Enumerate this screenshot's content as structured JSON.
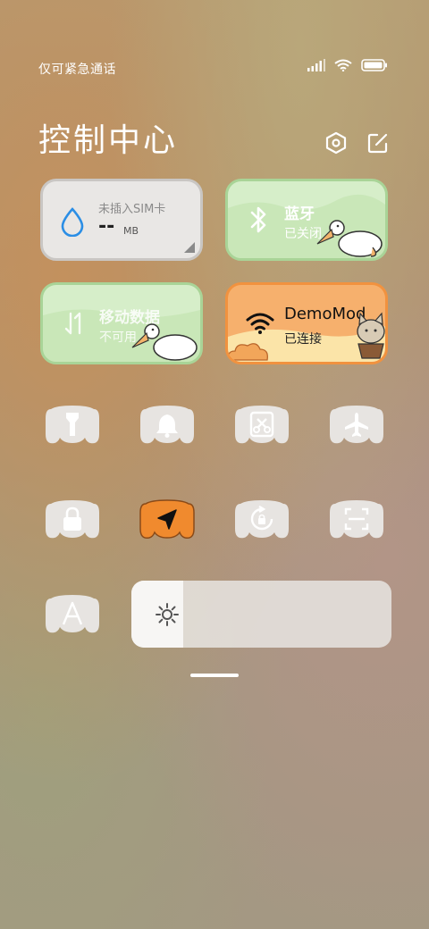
{
  "status_bar": {
    "carrier_text": "仅可紧急通话",
    "icons": [
      "signal-icon",
      "wifi-icon",
      "battery-icon"
    ]
  },
  "header": {
    "title": "控制中心",
    "icons": [
      "settings-hexagon-icon",
      "edit-icon"
    ]
  },
  "tiles": {
    "data_usage": {
      "label": "未插入SIM卡",
      "value": "--",
      "unit": "MB"
    },
    "bluetooth": {
      "title": "蓝牙",
      "status": "已关闭"
    },
    "mobile_data": {
      "title": "移动数据",
      "status": "不可用"
    },
    "wifi": {
      "title": "DemoMod",
      "status": "已连接"
    }
  },
  "toggles": [
    {
      "icon": "flashlight-icon",
      "active": false
    },
    {
      "icon": "bell-icon",
      "active": false
    },
    {
      "icon": "screenshot-icon",
      "active": false
    },
    {
      "icon": "airplane-icon",
      "active": false
    },
    {
      "icon": "lock-icon",
      "active": false
    },
    {
      "icon": "location-icon",
      "active": true
    },
    {
      "icon": "rotation-lock-icon",
      "active": false
    },
    {
      "icon": "scan-icon",
      "active": false
    },
    {
      "icon": "auto-brightness-icon",
      "active": false
    }
  ],
  "brightness": {
    "icon": "sun-icon",
    "level": 0.2
  },
  "colors": {
    "tile_green": "#d3edc6",
    "tile_gray": "#e8e6e4",
    "tile_orange": "#f6a86a",
    "toggle_off": "#e6e3e0",
    "toggle_on": "#f08a2e"
  }
}
